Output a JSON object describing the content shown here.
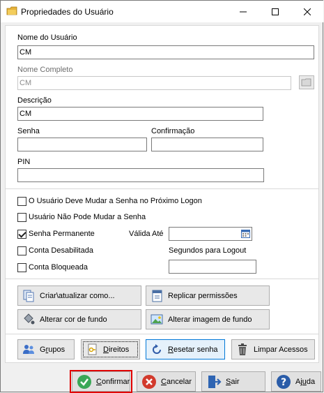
{
  "window": {
    "title": "Propriedades do Usuário",
    "minimize_icon": "minimize-icon",
    "maximize_icon": "maximize-icon",
    "close_icon": "close-icon"
  },
  "fields": {
    "username_label": "Nome do Usuário",
    "username_value": "CM",
    "fullname_label": "Nome Completo",
    "fullname_value": "CM",
    "description_label": "Descrição",
    "description_value": "CM",
    "password_label": "Senha",
    "password_value": "",
    "confirmation_label": "Confirmação",
    "confirmation_value": "",
    "pin_label": "PIN",
    "pin_value": ""
  },
  "options": {
    "must_change": {
      "label": "O Usuário Deve Mudar a Senha no Próximo Logon",
      "checked": false
    },
    "cannot_change": {
      "label": "Usuário Não Pode Mudar a Senha",
      "checked": false
    },
    "permanent": {
      "label": "Senha Permanente",
      "checked": true
    },
    "disabled": {
      "label": "Conta Desabilitada",
      "checked": false
    },
    "locked": {
      "label": "Conta Bloqueada",
      "checked": false
    },
    "valid_until_label": "Válida Até",
    "valid_until_value": "",
    "logout_label": "Segundos para Logout",
    "logout_value": ""
  },
  "actions": {
    "create_update": "Criar\\atualizar como...",
    "replicate": "Replicar permissões",
    "bg_color": "Alterar cor de fundo",
    "bg_image": "Alterar imagem de fundo"
  },
  "tools": {
    "groups_pre": "G",
    "groups_u": "r",
    "groups_post": "upos",
    "rights_pre": "",
    "rights_u": "D",
    "rights_post": "ireitos",
    "reset_pre": "",
    "reset_u": "R",
    "reset_post": "esetar senha",
    "clear": "Limpar Acessos"
  },
  "footer": {
    "confirm_pre": "",
    "confirm_u": "C",
    "confirm_post": "onfirmar",
    "cancel_pre": "",
    "cancel_u": "C",
    "cancel_post": "ancelar",
    "exit_pre": "",
    "exit_u": "S",
    "exit_post": "air",
    "help_pre": "Aj",
    "help_u": "u",
    "help_post": "da"
  },
  "colors": {
    "accent": "#0078d7",
    "highlight": "#e00000",
    "confirm_icon": "#3aa757",
    "cancel_icon": "#d23a2c",
    "help_icon": "#2a5ca8"
  }
}
